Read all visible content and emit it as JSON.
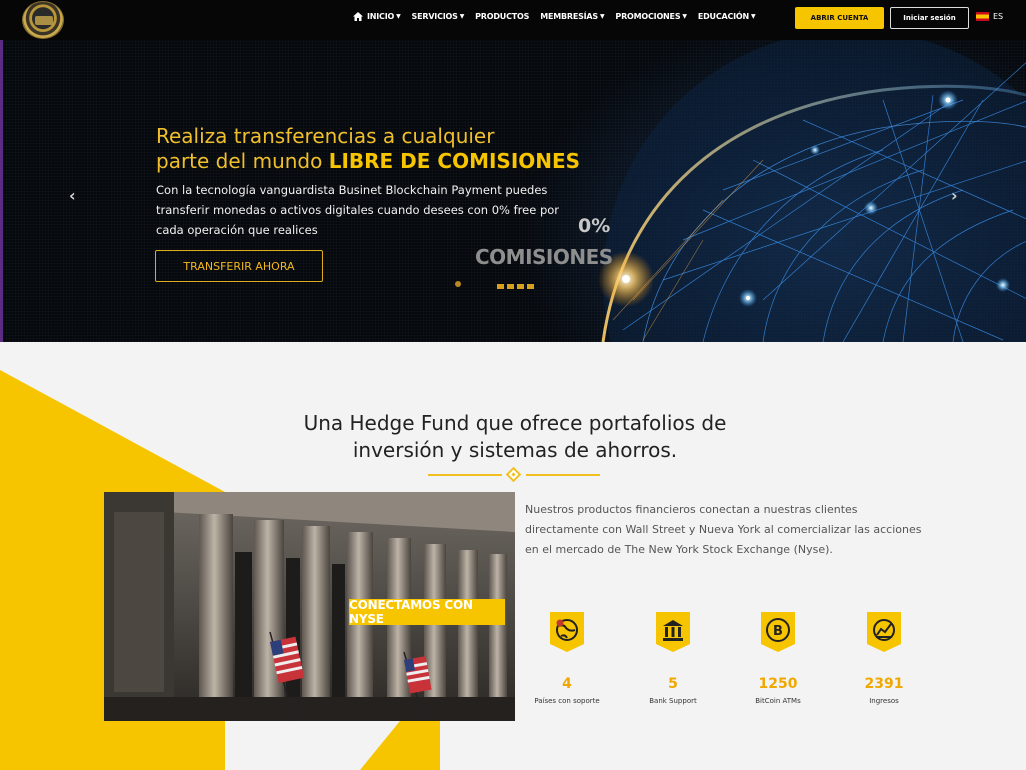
{
  "nav": {
    "items": [
      {
        "label": "INICIO"
      },
      {
        "label": "SERVICIOS"
      },
      {
        "label": "PRODUCTOS"
      },
      {
        "label": "MEMBRESÍAS"
      },
      {
        "label": "PROMOCIONES"
      },
      {
        "label": "EDUCACIÓN"
      }
    ],
    "open_account": "ABRIR CUENTA",
    "login": "Iniciar sesión",
    "language": "ES"
  },
  "hero": {
    "title_line1": "Realiza transferencias a cualquier",
    "title_line2_prefix": "parte del mundo ",
    "title_line2_bold": "LIBRE DE COMISIONES",
    "description": "Con la tecnología vanguardista Businet Blockchain Payment puedes transferir monedas o activos digitales cuando desees con 0% free por cada operación que realices",
    "button": "TRANSFERIR AHORA",
    "graphic_percent": "0%",
    "graphic_word": "COMISIONES",
    "prev_icon": "chevron-left-icon",
    "next_icon": "chevron-right-icon"
  },
  "section": {
    "title_line1": "Una Hedge Fund que ofrece portafolios de",
    "title_line2": "inversión y sistemas de ahorros.",
    "image_badge": "CONECTAMOS CON NYSE",
    "description": "Nuestros productos financieros conectan a nuestras clientes directamente con Wall Street y Nueva York al comercializar las acciones en el mercado de The New York Stock Exchange (Nyse)."
  },
  "stats": [
    {
      "value": "4",
      "label": "Países con soporte",
      "icon": "globe-icon"
    },
    {
      "value": "5",
      "label": "Bank Support",
      "icon": "bank-icon"
    },
    {
      "value": "1250",
      "label": "BitCoin ATMs",
      "icon": "bitcoin-icon"
    },
    {
      "value": "2391",
      "label": "Ingresos",
      "icon": "income-icon"
    }
  ],
  "colors": {
    "accent": "#f7c400",
    "nav_bg": "#060606",
    "stat_value": "#f0a800"
  }
}
